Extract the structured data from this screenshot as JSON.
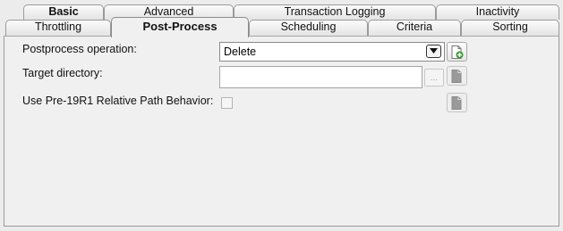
{
  "tabs": {
    "row_back": [
      {
        "id": "basic",
        "label": "Basic"
      },
      {
        "id": "advanced",
        "label": "Advanced"
      },
      {
        "id": "transaction-logging",
        "label": "Transaction Logging"
      },
      {
        "id": "inactivity",
        "label": "Inactivity"
      }
    ],
    "row_front": [
      {
        "id": "throttling",
        "label": "Throttling"
      },
      {
        "id": "post-process",
        "label": "Post-Process",
        "selected": true
      },
      {
        "id": "scheduling",
        "label": "Scheduling"
      },
      {
        "id": "criteria",
        "label": "Criteria"
      },
      {
        "id": "sorting",
        "label": "Sorting"
      }
    ]
  },
  "form": {
    "postprocess": {
      "label": "Postprocess operation:",
      "value": "Delete"
    },
    "target_directory": {
      "label": "Target directory:",
      "value": "",
      "browse_label": "..."
    },
    "relative_path": {
      "label": "Use Pre-19R1 Relative Path Behavior:",
      "checked": false
    }
  },
  "icons": {
    "combo_arrow": "chevron-down-icon",
    "add_variable": "document-add-icon",
    "variable_disabled": "document-icon"
  },
  "colors": {
    "add_icon_green": "#2e9a2e",
    "panel_bg": "#f0f0f0"
  }
}
